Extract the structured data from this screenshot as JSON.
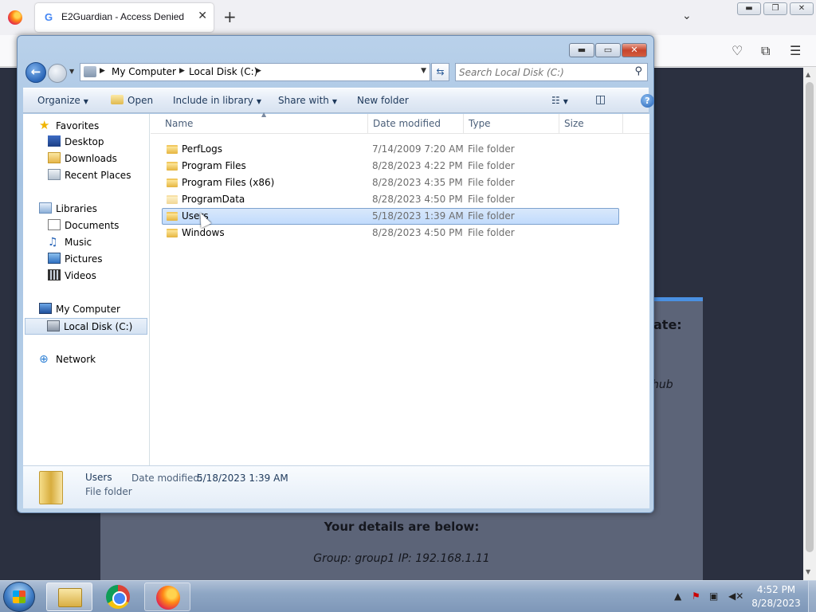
{
  "browser": {
    "tab_title": "E2Guardian - Access Denied",
    "tab_favicon": "google-g-icon",
    "new_tab": "+",
    "page": {
      "fragment_1": "ate:",
      "fragment_2": "hub",
      "details_heading": "Your details are below:",
      "details_line": "Group: group1   IP: 192.168.1.11"
    }
  },
  "explorer": {
    "breadcrumb": [
      "My Computer",
      "Local Disk (C:)"
    ],
    "search_placeholder": "Search Local Disk (C:)",
    "toolbar": {
      "organize": "Organize",
      "open": "Open",
      "include": "Include in library",
      "share": "Share with",
      "new_folder": "New folder"
    },
    "nav": {
      "favorites": "Favorites",
      "desktop": "Desktop",
      "downloads": "Downloads",
      "recent": "Recent Places",
      "libraries": "Libraries",
      "documents": "Documents",
      "music": "Music",
      "pictures": "Pictures",
      "videos": "Videos",
      "computer": "My Computer",
      "disk": "Local Disk (C:)",
      "network": "Network"
    },
    "columns": {
      "name": "Name",
      "date": "Date modified",
      "type": "Type",
      "size": "Size"
    },
    "files": [
      {
        "name": "PerfLogs",
        "date": "7/14/2009 7:20 AM",
        "type": "File folder"
      },
      {
        "name": "Program Files",
        "date": "8/28/2023 4:22 PM",
        "type": "File folder"
      },
      {
        "name": "Program Files (x86)",
        "date": "8/28/2023 4:35 PM",
        "type": "File folder"
      },
      {
        "name": "ProgramData",
        "date": "8/28/2023 4:50 PM",
        "type": "File folder"
      },
      {
        "name": "Users",
        "date": "5/18/2023 1:39 AM",
        "type": "File folder"
      },
      {
        "name": "Windows",
        "date": "8/28/2023 4:50 PM",
        "type": "File folder"
      }
    ],
    "selected_index": 4,
    "details": {
      "name": "Users",
      "kind": "File folder",
      "label": "Date modified:",
      "value": "5/18/2023 1:39 AM"
    }
  },
  "taskbar": {
    "clock_time": "4:52 PM",
    "clock_date": "8/28/2023"
  }
}
